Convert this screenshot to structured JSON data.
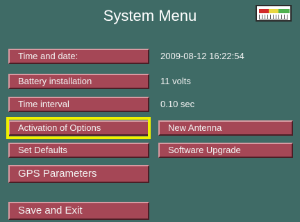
{
  "header": {
    "title": "System Menu",
    "meter_icon": "battery-meter-icon"
  },
  "menu": {
    "time_and_date": "Time and date:",
    "battery_installation": "Battery installation",
    "time_interval": "Time interval",
    "activation_of_options": "Activation of Options",
    "set_defaults": "Set Defaults",
    "gps_parameters": "GPS Parameters",
    "save_and_exit": "Save and Exit"
  },
  "values": {
    "time_and_date": "2009-08-12  16:22:54",
    "battery": "11 volts",
    "interval": "0.10 sec"
  },
  "options": {
    "new_antenna": "New Antenna",
    "software_upgrade": "Software Upgrade"
  },
  "colors": {
    "background": "#3f6b66",
    "button": "#a54756",
    "selection": "#f0f000"
  }
}
